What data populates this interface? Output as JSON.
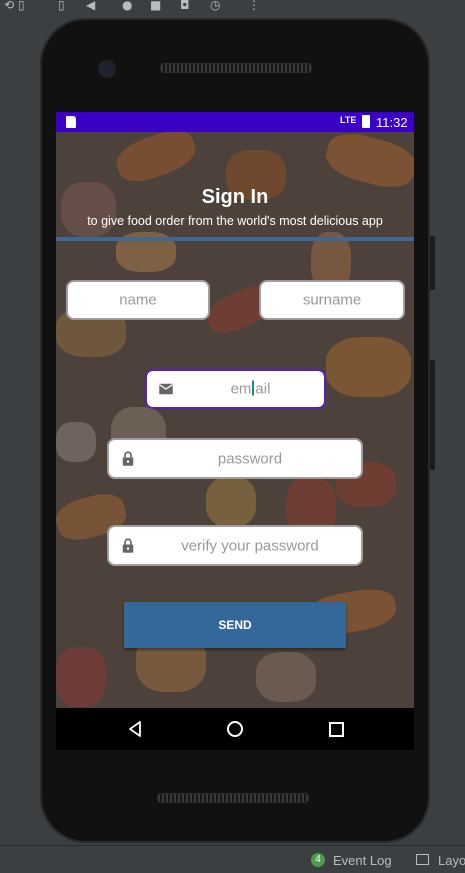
{
  "ide": {
    "event_log_count": "4",
    "event_log_label": "Event Log",
    "layout_label": "Layo"
  },
  "status_bar": {
    "time": "11:32",
    "signal_label": "LTE"
  },
  "signin": {
    "title": "Sign In",
    "subtitle": "to give food order from the world's most delicious app"
  },
  "form": {
    "name_placeholder": "name",
    "surname_placeholder": "surname",
    "email_before_caret": "em",
    "email_after_caret": "ail",
    "password_placeholder": "password",
    "verify_placeholder": "verify your password",
    "send_label": "SEND"
  },
  "colors": {
    "status_bar": "#3a00c8",
    "accent_line": "#3a6897",
    "send_button": "#35689a",
    "active_border": "#5a1fb5"
  }
}
